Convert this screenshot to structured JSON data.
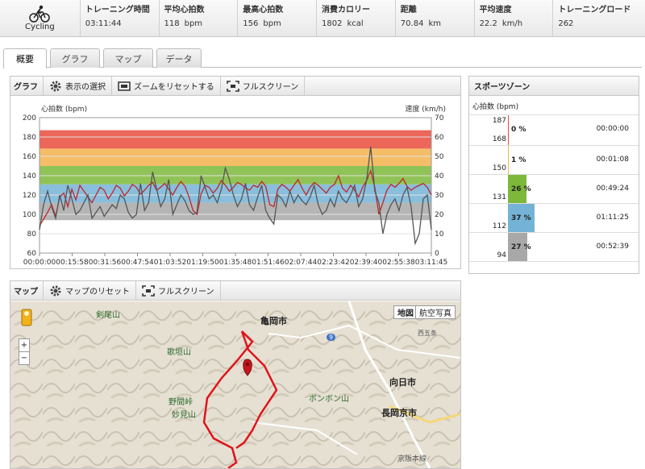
{
  "summary": {
    "sport_label": "Cycling",
    "stats": [
      {
        "label": "トレーニング時間",
        "value": "03:11:44",
        "unit": ""
      },
      {
        "label": "平均心拍数",
        "value": "118",
        "unit": "bpm"
      },
      {
        "label": "最高心拍数",
        "value": "156",
        "unit": "bpm"
      },
      {
        "label": "消費カロリー",
        "value": "1802",
        "unit": "kcal"
      },
      {
        "label": "距離",
        "value": "70.84",
        "unit": "km"
      },
      {
        "label": "平均速度",
        "value": "22.2",
        "unit": "km/h"
      },
      {
        "label": "トレーニングロード",
        "value": "262",
        "unit": ""
      }
    ]
  },
  "tabs": [
    "概要",
    "グラフ",
    "マップ",
    "データ"
  ],
  "graph_panel": {
    "title": "グラフ",
    "buttons": [
      {
        "label": "表示の選択",
        "icon": "gear-icon"
      },
      {
        "label": "ズームをリセットする",
        "icon": "zoom-reset-icon"
      },
      {
        "label": "フルスクリーン",
        "icon": "fullscreen-icon"
      }
    ],
    "left_axis_title": "心拍数 (bpm)",
    "right_axis_title": "速度 (km/h)"
  },
  "zones_panel": {
    "title": "スポーツゾーン",
    "caption": "心拍数 (bpm)",
    "zones": [
      {
        "high": "187",
        "low": "168",
        "percent": "0 %",
        "time": "00:00:00",
        "fraction": 0.0,
        "color": "#e94b3c"
      },
      {
        "high": "",
        "low": "150",
        "percent": "1 %",
        "time": "00:01:08",
        "fraction": 0.01,
        "color": "#f3b24c"
      },
      {
        "high": "",
        "low": "131",
        "percent": "26 %",
        "time": "00:49:24",
        "fraction": 0.26,
        "color": "#7cb83a"
      },
      {
        "high": "",
        "low": "112",
        "percent": "37 %",
        "time": "01:11:25",
        "fraction": 0.37,
        "color": "#74b3d6"
      },
      {
        "high": "",
        "low": "94",
        "percent": "27 %",
        "time": "00:52:39",
        "fraction": 0.27,
        "color": "#a8a8a8"
      }
    ]
  },
  "map_panel": {
    "title": "マップ",
    "buttons": [
      {
        "label": "マップのリセット",
        "icon": "gear-icon"
      },
      {
        "label": "フルスクリーン",
        "icon": "fullscreen-icon"
      }
    ],
    "map_type_buttons": [
      "地図",
      "航空写真"
    ],
    "zoom_in": "+",
    "zoom_out": "−",
    "places": [
      "剣尾山",
      "亀岡市",
      "歌垣山",
      "野間峠",
      "妙見山",
      "ボンボン山",
      "向日市",
      "長岡京市",
      "京阪本線",
      "西五条",
      "9"
    ]
  },
  "chart_data": {
    "type": "line",
    "title": "",
    "xlabel": "",
    "ylabel": "心拍数 (bpm)",
    "y2label": "速度 (km/h)",
    "ylim": [
      60,
      200
    ],
    "y2lim": [
      0,
      70
    ],
    "x_ticks": [
      "00:00:00",
      "00:15:58",
      "00:31:56",
      "00:47:54",
      "01:03:52",
      "01:19:50",
      "01:35:48",
      "01:51:46",
      "02:07:44",
      "02:23:42",
      "02:39:40",
      "02:55:38",
      "03:11:45"
    ],
    "y_ticks": [
      60,
      80,
      100,
      120,
      140,
      160,
      180,
      200
    ],
    "y2_ticks": [
      0,
      10,
      20,
      30,
      40,
      50,
      60,
      70
    ],
    "zone_bands": [
      {
        "from": 168,
        "to": 187,
        "color": "#e94b3c"
      },
      {
        "from": 150,
        "to": 168,
        "color": "#f3b24c"
      },
      {
        "from": 131,
        "to": 150,
        "color": "#7cb83a"
      },
      {
        "from": 112,
        "to": 131,
        "color": "#74b3d6"
      },
      {
        "from": 94,
        "to": 112,
        "color": "#a8a8a8"
      }
    ],
    "series": [
      {
        "name": "心拍数",
        "axis": "left",
        "color": "#c0272d",
        "values": [
          88,
          95,
          102,
          110,
          98,
          118,
          122,
          108,
          126,
          115,
          130,
          124,
          118,
          112,
          120,
          128,
          125,
          116,
          122,
          130,
          127,
          119,
          124,
          131,
          128,
          121,
          125,
          130,
          133,
          125,
          128,
          132,
          126,
          120,
          128,
          134,
          129,
          118,
          104,
          100,
          121,
          130,
          128,
          122,
          127,
          135,
          130,
          124,
          128,
          133,
          131,
          127,
          125,
          130,
          128,
          134,
          129,
          110,
          108,
          126,
          131,
          128,
          124,
          130,
          136,
          127,
          120,
          128,
          133,
          130,
          126,
          122,
          128,
          131,
          140,
          127,
          123,
          130,
          125,
          118,
          128,
          135,
          145,
          128,
          100,
          112,
          125,
          131,
          128,
          132,
          137,
          129,
          125,
          128,
          130,
          132,
          128,
          120
        ]
      },
      {
        "name": "速度",
        "axis": "right",
        "color": "#555555",
        "values": [
          12,
          25,
          32,
          24,
          18,
          30,
          22,
          35,
          28,
          20,
          22,
          26,
          30,
          18,
          21,
          24,
          19,
          22,
          25,
          23,
          30,
          28,
          21,
          18,
          20,
          36,
          22,
          26,
          42,
          33,
          24,
          28,
          38,
          20,
          25,
          30,
          27,
          22,
          20,
          21,
          40,
          34,
          28,
          30,
          26,
          33,
          44,
          38,
          30,
          24,
          28,
          36,
          25,
          22,
          29,
          35,
          22,
          18,
          15,
          30,
          28,
          24,
          32,
          26,
          30,
          27,
          25,
          29,
          35,
          25,
          20,
          22,
          28,
          24,
          32,
          28,
          26,
          30,
          35,
          24,
          28,
          38,
          55,
          32,
          26,
          10,
          20,
          25,
          28,
          22,
          30,
          34,
          24,
          5,
          10,
          28,
          30,
          12
        ]
      }
    ]
  }
}
